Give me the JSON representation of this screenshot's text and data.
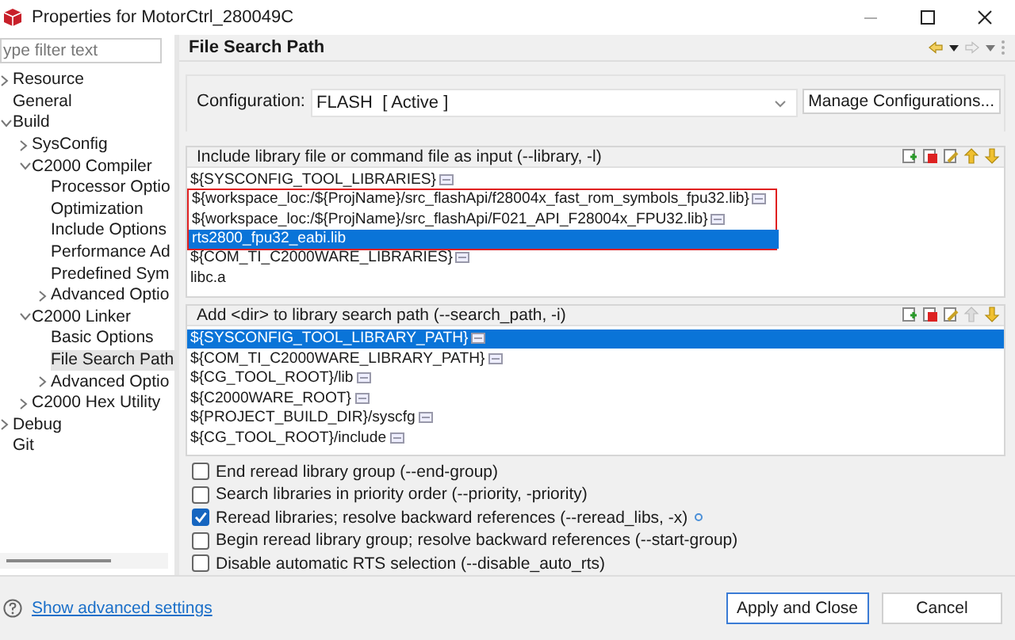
{
  "window": {
    "title": "Properties for MotorCtrl_280049C"
  },
  "filter": {
    "placeholder": "ype filter text"
  },
  "tree": [
    {
      "label": "Resource",
      "expanded": false,
      "selected": false
    },
    {
      "label": "General",
      "selected": false
    },
    {
      "label": "Build",
      "expanded": true,
      "selected": false,
      "children": [
        {
          "label": "SysConfig",
          "expanded": false,
          "selected": false
        },
        {
          "label": "C2000 Compiler",
          "expanded": true,
          "selected": false,
          "children": [
            {
              "label": "Processor Optio",
              "selected": false
            },
            {
              "label": "Optimization",
              "selected": false
            },
            {
              "label": "Include Options",
              "selected": false
            },
            {
              "label": "Performance Ad",
              "selected": false
            },
            {
              "label": "Predefined Sym",
              "selected": false
            },
            {
              "label": "Advanced Optio",
              "expanded": false,
              "selected": false
            }
          ]
        },
        {
          "label": "C2000 Linker",
          "expanded": true,
          "selected": false,
          "children": [
            {
              "label": "Basic Options",
              "selected": false
            },
            {
              "label": "File Search Path",
              "selected": true
            },
            {
              "label": "Advanced Optio",
              "expanded": false,
              "selected": false
            }
          ]
        },
        {
          "label": "C2000 Hex Utility",
          "expanded": false,
          "selected": false
        }
      ]
    },
    {
      "label": "Debug",
      "expanded": false,
      "selected": false
    },
    {
      "label": "Git",
      "selected": false
    }
  ],
  "page": {
    "title": "File Search Path"
  },
  "configuration": {
    "label": "Configuration:",
    "value": "FLASH  [ Active ]",
    "manage_button": "Manage Configurations..."
  },
  "include_libraries": {
    "title": "Include library file or command file as input (--library, -l)",
    "toolbar": [
      {
        "kind": "add",
        "disabled": false
      },
      {
        "kind": "remove",
        "disabled": false
      },
      {
        "kind": "edit",
        "disabled": false
      },
      {
        "kind": "up",
        "disabled": false
      },
      {
        "kind": "down",
        "disabled": false
      }
    ],
    "items": [
      {
        "text": "${SYSCONFIG_TOOL_LIBRARIES}",
        "variable_icon": true,
        "selected": false,
        "marked": false
      },
      {
        "text": "${workspace_loc:/${ProjName}/src_flashApi/f28004x_fast_rom_symbols_fpu32.lib}",
        "variable_icon": true,
        "selected": false,
        "marked": true
      },
      {
        "text": "${workspace_loc:/${ProjName}/src_flashApi/F021_API_F28004x_FPU32.lib}",
        "variable_icon": true,
        "selected": false,
        "marked": true
      },
      {
        "text": "rts2800_fpu32_eabi.lib",
        "variable_icon": false,
        "selected": true,
        "marked": true
      },
      {
        "text": "${COM_TI_C2000WARE_LIBRARIES}",
        "variable_icon": true,
        "selected": false,
        "marked": false
      },
      {
        "text": "libc.a",
        "variable_icon": false,
        "selected": false,
        "marked": false
      }
    ]
  },
  "search_paths": {
    "title": "Add <dir> to library search path (--search_path, -i)",
    "toolbar": [
      {
        "kind": "add",
        "disabled": false
      },
      {
        "kind": "remove",
        "disabled": false
      },
      {
        "kind": "edit",
        "disabled": false
      },
      {
        "kind": "up",
        "disabled": true
      },
      {
        "kind": "down",
        "disabled": false
      }
    ],
    "items": [
      {
        "text": "${SYSCONFIG_TOOL_LIBRARY_PATH}",
        "variable_icon": true,
        "selected": true,
        "marked": false
      },
      {
        "text": "${COM_TI_C2000WARE_LIBRARY_PATH}",
        "variable_icon": true,
        "selected": false,
        "marked": false
      },
      {
        "text": "${CG_TOOL_ROOT}/lib",
        "variable_icon": true,
        "selected": false,
        "marked": false
      },
      {
        "text": "${C2000WARE_ROOT}",
        "variable_icon": true,
        "selected": false,
        "marked": false
      },
      {
        "text": "${PROJECT_BUILD_DIR}/syscfg",
        "variable_icon": true,
        "selected": false,
        "marked": false
      },
      {
        "text": "${CG_TOOL_ROOT}/include",
        "variable_icon": true,
        "selected": false,
        "marked": false
      }
    ]
  },
  "options": [
    {
      "label": "End reread library group (--end-group)",
      "checked": false,
      "info": false
    },
    {
      "label": "Search libraries in priority order (--priority, -priority)",
      "checked": false,
      "info": false
    },
    {
      "label": "Reread libraries; resolve backward references (--reread_libs, -x)",
      "checked": true,
      "info": true
    },
    {
      "label": "Begin reread library group; resolve backward references (--start-group)",
      "checked": false,
      "info": false
    },
    {
      "label": "Disable automatic RTS selection (--disable_auto_rts)",
      "checked": false,
      "info": false
    }
  ],
  "footer": {
    "help_link": "Show advanced settings",
    "buttons": [
      {
        "label": "Apply and Close",
        "default": true
      },
      {
        "label": "Cancel",
        "default": false
      }
    ]
  }
}
